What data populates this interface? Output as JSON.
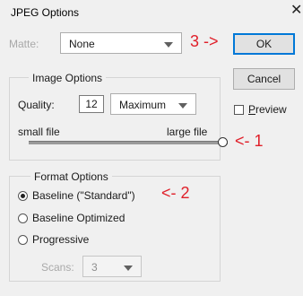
{
  "window": {
    "title": "JPEG Options",
    "close_glyph": "✕"
  },
  "matte": {
    "label": "Matte:",
    "value": "None"
  },
  "buttons": {
    "ok_label": "OK",
    "cancel_label": "Cancel"
  },
  "preview": {
    "label": "Preview",
    "checked": false
  },
  "image_options": {
    "group_title": "Image Options",
    "quality_label": "Quality:",
    "quality_value": "12",
    "quality_preset": "Maximum",
    "small_label": "small file",
    "large_label": "large file",
    "slider_fraction": 1.0
  },
  "format_options": {
    "group_title": "Format Options",
    "options": [
      {
        "label": "Baseline (\"Standard\")",
        "selected": true
      },
      {
        "label": "Baseline Optimized",
        "selected": false
      },
      {
        "label": "Progressive",
        "selected": false
      }
    ],
    "scans_label": "Scans:",
    "scans_value": "3"
  },
  "annotations": {
    "a1": "<- 1",
    "a2": "<- 2",
    "a3": "3 ->",
    "color": "#e0202a"
  }
}
